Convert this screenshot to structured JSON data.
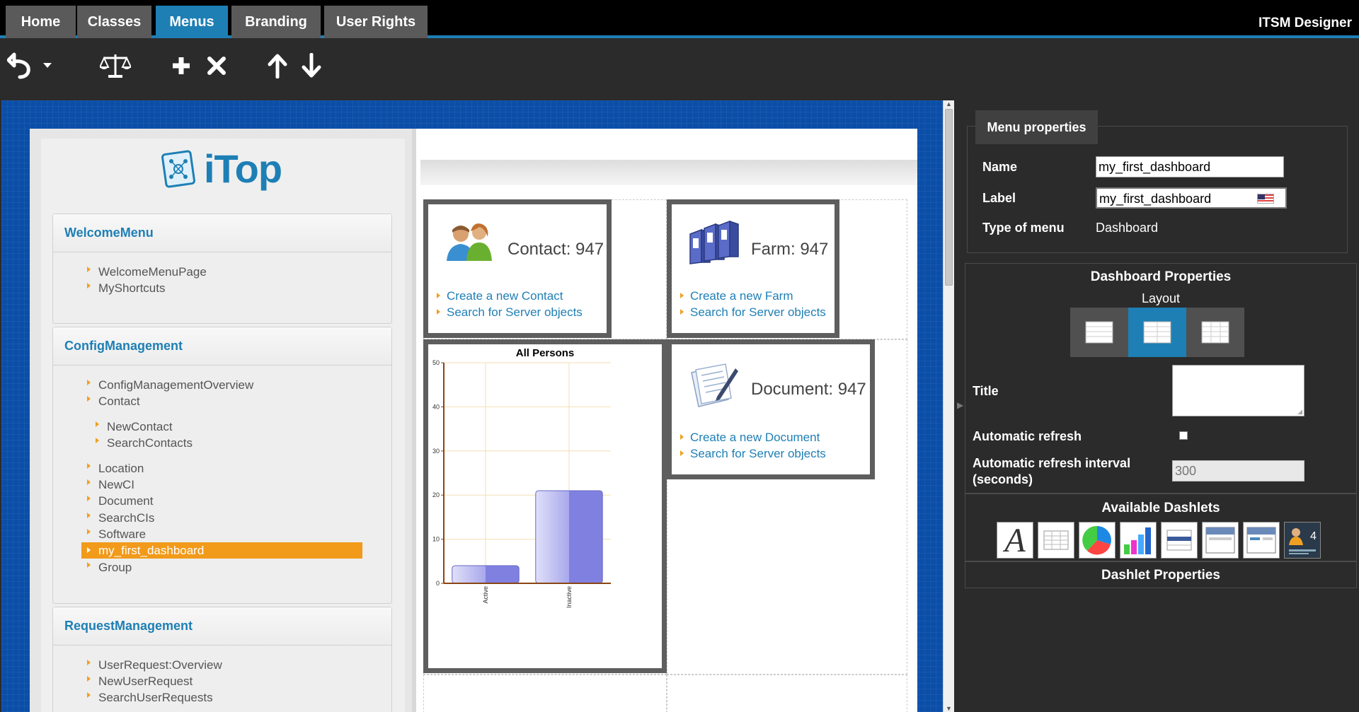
{
  "nav": {
    "tabs": [
      {
        "label": "Home"
      },
      {
        "label": "Classes"
      },
      {
        "label": "Menus",
        "active": true
      },
      {
        "label": "Branding"
      },
      {
        "label": "User Rights"
      }
    ],
    "app_title": "ITSM Designer",
    "accent_color": "#1e7fb5"
  },
  "toolbar": {
    "icons": [
      "undo-icon",
      "dropdown-arrow-icon",
      "scales-icon",
      "add-icon",
      "delete-icon",
      "move-up-icon",
      "move-down-icon"
    ]
  },
  "preview": {
    "logo_text": "iTop",
    "menu_groups": [
      {
        "title": "WelcomeMenu",
        "items": [
          "WelcomeMenuPage",
          "MyShortcuts"
        ]
      },
      {
        "title": "ConfigManagement",
        "items": [
          "ConfigManagementOverview",
          "Contact",
          "NewContact",
          "SearchContacts",
          "Location",
          "NewCI",
          "Document",
          "SearchCIs",
          "Software",
          "my_first_dashboard",
          "Group"
        ]
      },
      {
        "title": "RequestManagement",
        "items": [
          "UserRequest:Overview",
          "NewUserRequest",
          "SearchUserRequests"
        ]
      }
    ],
    "selected_item": "my_first_dashboard",
    "dashlets": {
      "contact": {
        "title": "Contact: 947",
        "link1": "Create a new Contact",
        "link2": "Search for Server objects"
      },
      "farm": {
        "title": "Farm: 947",
        "link1": "Create a new Farm",
        "link2": "Search for Server objects"
      },
      "document": {
        "title": "Document: 947",
        "link1": "Create a new Document",
        "link2": "Search for Server objects"
      }
    }
  },
  "chart_data": {
    "type": "bar",
    "title": "All Persons",
    "categories": [
      "Active",
      "Inactive"
    ],
    "values": [
      4,
      21
    ],
    "ylim": [
      0,
      50
    ],
    "yticks": [
      0,
      10,
      20,
      30,
      40,
      50
    ],
    "grid": true,
    "bar_color": "#8080e0"
  },
  "menu_properties": {
    "tab_label": "Menu properties",
    "name_label": "Name",
    "name_value": "my_first_dashboard",
    "label_label": "Label",
    "label_value": "my_first_dashboard",
    "type_label": "Type of menu",
    "type_value": "Dashboard"
  },
  "dashboard_properties": {
    "heading": "Dashboard Properties",
    "layout_label": "Layout",
    "layout_options": [
      "one-column-layout-icon",
      "two-columns-layout-icon",
      "three-columns-layout-icon"
    ],
    "active_layout": 1,
    "title_label": "Title",
    "title_value": "",
    "auto_refresh_label": "Automatic refresh",
    "auto_refresh_checked": false,
    "interval_label_line1": "Automatic refresh interval",
    "interval_label_line2": "(seconds)",
    "interval_value": "300"
  },
  "available_dashlets": {
    "heading": "Available Dashlets",
    "icons": [
      "text-dashlet-icon",
      "table-dashlet-icon",
      "pie-chart-dashlet-icon",
      "bar-chart-dashlet-icon",
      "list-dashlet-icon",
      "header-dashlet-icon",
      "header-dynamic-dashlet-icon",
      "badge-dashlet-icon"
    ]
  },
  "dashlet_properties": {
    "heading": "Dashlet Properties"
  }
}
